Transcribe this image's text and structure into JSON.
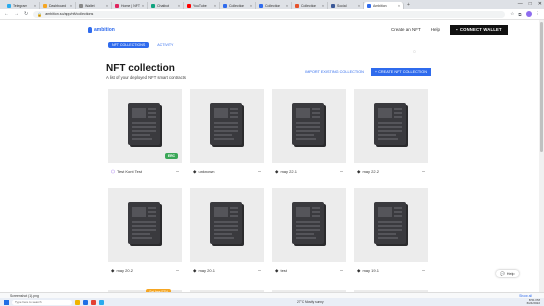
{
  "browser": {
    "tabs": [
      {
        "label": "Telegram",
        "color": "#2aabee"
      },
      {
        "label": "Dashboard",
        "color": "#f5a623"
      },
      {
        "label": "Wallet",
        "color": "#888888"
      },
      {
        "label": "Home | NFT",
        "color": "#e0245e"
      },
      {
        "label": "Chatbot",
        "color": "#10a37f"
      },
      {
        "label": "YouTube",
        "color": "#ff0000"
      },
      {
        "label": "Collection",
        "color": "#2f6bed"
      },
      {
        "label": "Collection",
        "color": "#2f6bed"
      },
      {
        "label": "Collection",
        "color": "#e6522c"
      },
      {
        "label": "Social",
        "color": "#3b5998"
      },
      {
        "label": "Ambition",
        "color": "#2f6bed",
        "active": true
      }
    ],
    "new_tab": "+",
    "window_controls": [
      "—",
      "□",
      "✕"
    ],
    "url": "ambition.so/app/nft/collections"
  },
  "site": {
    "logo": "ambition",
    "links": [
      "Create an NFT",
      "Help"
    ],
    "connect_label": "CONNECT WALLET"
  },
  "subnav": {
    "active": "NFT COLLECTIONS",
    "inactive": "ACTIVITY"
  },
  "page": {
    "title": "NFT collection",
    "subtitle": "A list of your deployed NFT smart contracts",
    "secondary_action": "IMPORT EXISTING COLLECTION",
    "primary_action": "+ CREATE NFT COLLECTION"
  },
  "cards": [
    {
      "label": "Test Kont Test",
      "chain": "polygon",
      "badge": "ERC"
    },
    {
      "label": "unknown",
      "chain": "ethereum",
      "badge": ""
    },
    {
      "label": "may 22.1",
      "chain": "ethereum",
      "badge": ""
    },
    {
      "label": "may 22.2",
      "chain": "ethereum",
      "badge": ""
    },
    {
      "label": "may 20.2",
      "chain": "ethereum",
      "badge": ""
    },
    {
      "label": "may 20.1",
      "chain": "ethereum",
      "badge": ""
    },
    {
      "label": "test",
      "chain": "ethereum",
      "badge": ""
    },
    {
      "label": "may 19.1",
      "chain": "ethereum",
      "badge": ""
    }
  ],
  "more_glyph": "···",
  "help_label": "Help",
  "promo_label": "Get free ETH",
  "download": {
    "file": "Screenshot (1).png",
    "show_all": "Show all"
  },
  "taskbar": {
    "search": "Type here to search",
    "weather": "27°C  Mostly sunny",
    "time": "8:51 PM",
    "date": "6/24/2022"
  }
}
